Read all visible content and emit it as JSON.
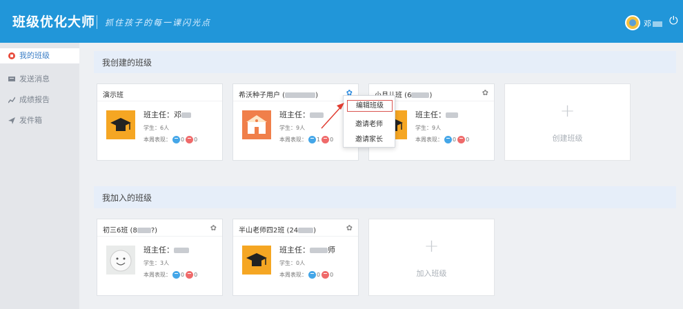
{
  "header": {
    "brand": "班级优化大师",
    "slogan": "抓住孩子的每一课闪光点",
    "user_name": "邓",
    "power_icon": "power-icon"
  },
  "sidebar": {
    "items": [
      {
        "label": "我的班级",
        "icon": "home-icon",
        "active": true
      },
      {
        "label": "发送消息",
        "icon": "message-icon",
        "active": false
      },
      {
        "label": "成绩报告",
        "icon": "chart-icon",
        "active": false
      },
      {
        "label": "发件箱",
        "icon": "send-icon",
        "active": false
      }
    ]
  },
  "created": {
    "title": "我创建的班级",
    "classes": [
      {
        "name": "演示班",
        "teacher_label": "班主任：",
        "teacher": "邓",
        "students": "学生：6人",
        "perf_label": "本周表现：",
        "good": "0",
        "bad": "0"
      },
      {
        "name": "希沃种子用户 (",
        "name_end": ")",
        "teacher_label": "班主任：",
        "teacher": "",
        "students": "学生：9人",
        "perf_label": "本周表现：",
        "good": "1",
        "bad": "0"
      },
      {
        "name": "小月儿班 (6",
        "name_end": ")",
        "teacher_label": "班主任：",
        "teacher": "",
        "students": "学生：9人",
        "perf_label": "本周表现：",
        "good": "0",
        "bad": "0"
      }
    ],
    "add_label": "创建班级"
  },
  "joined": {
    "title": "我加入的班级",
    "classes": [
      {
        "name": "初三6班 (8",
        "name_end": "?)",
        "teacher_label": "班主任：",
        "teacher": "",
        "students": "学生：3人",
        "perf_label": "本周表现：",
        "good": "0",
        "bad": "0"
      },
      {
        "name": "半山老师四2班 (24",
        "name_end": ")",
        "teacher_label": "班主任：",
        "teacher": "师",
        "students": "学生：0人",
        "perf_label": "本周表现：",
        "good": "0",
        "bad": "0"
      }
    ],
    "add_label": "加入班级"
  },
  "dropdown": {
    "items": [
      "编辑班级",
      "邀请老师",
      "邀请家长"
    ]
  },
  "colors": {
    "header": "#2196d9",
    "accent": "#f5a623",
    "highlight": "#d9534f"
  }
}
